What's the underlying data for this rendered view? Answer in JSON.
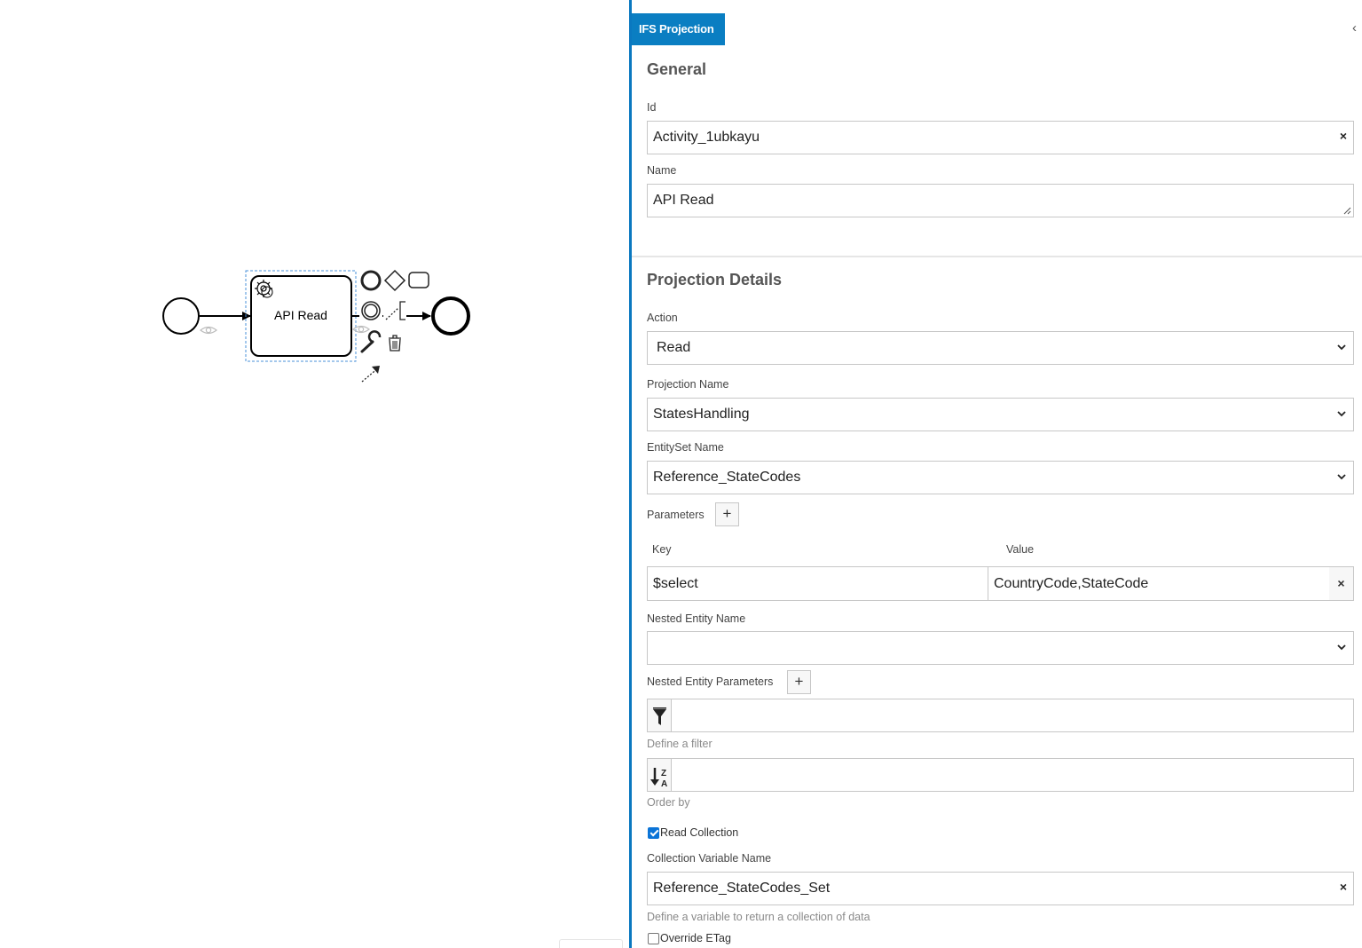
{
  "diagram": {
    "task_label": "API Read"
  },
  "panel": {
    "tab_label": "IFS Projection",
    "collapse_glyph": "‹",
    "general": {
      "title": "General",
      "id_label": "Id",
      "id_value": "Activity_1ubkayu",
      "name_label": "Name",
      "name_value": "API Read"
    },
    "projection": {
      "title": "Projection Details",
      "action_label": "Action",
      "action_value": "Read",
      "projection_name_label": "Projection Name",
      "projection_name_value": "StatesHandling",
      "entityset_label": "EntitySet Name",
      "entityset_value": "Reference_StateCodes",
      "parameters_label": "Parameters",
      "key_header": "Key",
      "value_header": "Value",
      "parameters": [
        {
          "key": "$select",
          "value": "CountryCode,StateCode"
        }
      ],
      "nested_entity_label": "Nested Entity Name",
      "nested_entity_value": "",
      "nested_params_label": "Nested Entity Parameters",
      "filter_value": "",
      "filter_hint": "Define a filter",
      "orderby_value": "",
      "orderby_hint": "Order by",
      "read_collection_label": "Read Collection",
      "read_collection_checked": true,
      "collection_var_label": "Collection Variable Name",
      "collection_var_value": "Reference_StateCodes_Set",
      "collection_var_hint": "Define a variable to return a collection of data",
      "override_etag_label": "Override ETag",
      "override_etag_checked": false
    },
    "clear_glyph": "×",
    "plus_glyph": "+"
  },
  "colors": {
    "accent": "#0a7ec2",
    "panel_border": "#0a78c0",
    "selection_outline": "#4a90d9",
    "checkbox": "#0b74d7"
  },
  "icons": [
    "gear-icon",
    "eye-icon",
    "wrench-icon",
    "trash-icon",
    "filter-icon",
    "sort-za-icon",
    "chevron-down-icon",
    "close-icon",
    "plus-icon"
  ]
}
